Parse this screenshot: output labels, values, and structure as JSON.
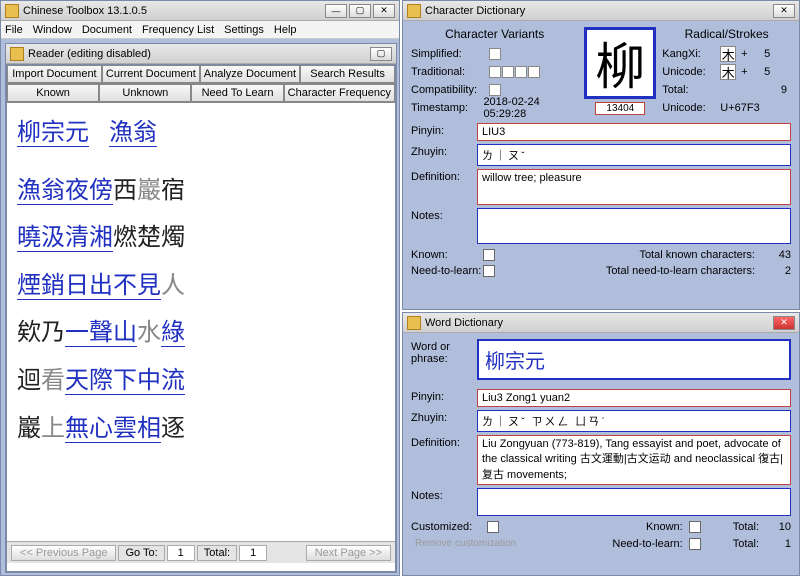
{
  "main": {
    "title": "Chinese Toolbox 13.1.0.5",
    "menu": [
      "File",
      "Window",
      "Document",
      "Frequency List",
      "Settings",
      "Help"
    ]
  },
  "reader": {
    "title": "Reader (editing disabled)",
    "buttons_row1": [
      "Import Document",
      "Current Document",
      "Analyze Document",
      "Search Results"
    ],
    "buttons_row2": [
      "Known",
      "Unknown",
      "Need To Learn",
      "Character Frequency"
    ],
    "poem_title_a": "柳宗元",
    "poem_title_b": "漁翁",
    "lines": [
      [
        [
          "漁翁",
          "kw"
        ],
        [
          "夜傍",
          "kw"
        ],
        [
          "西",
          "p"
        ],
        [
          "巖",
          "lt"
        ],
        [
          "宿",
          "p"
        ]
      ],
      [
        [
          "曉汲",
          "kw"
        ],
        [
          "清湘",
          "kw"
        ],
        [
          "燃",
          "p"
        ],
        [
          "楚",
          "p"
        ],
        [
          "燭",
          "p"
        ]
      ],
      [
        [
          "煙銷",
          "kw"
        ],
        [
          "日出",
          "kw"
        ],
        [
          "不見",
          "kw"
        ],
        [
          "人",
          "lt"
        ]
      ],
      [
        [
          "欸乃",
          "p"
        ],
        [
          "一聲",
          "kw"
        ],
        [
          "山",
          "kw"
        ],
        [
          "水",
          "lt"
        ],
        [
          "綠",
          "kw"
        ]
      ],
      [
        [
          "迴",
          "p"
        ],
        [
          "看",
          "lt"
        ],
        [
          "天際",
          "kw"
        ],
        [
          "下",
          "kw"
        ],
        [
          "中",
          "kw"
        ],
        [
          "流",
          "kw"
        ]
      ],
      [
        [
          "巖",
          "p"
        ],
        [
          "上",
          "lt"
        ],
        [
          "無心",
          "kw"
        ],
        [
          "雲",
          "kw"
        ],
        [
          "相",
          "kw"
        ],
        [
          "逐",
          "p"
        ]
      ]
    ],
    "status": {
      "prev": "<< Previous Page",
      "goto": "Go To:",
      "goto_val": "1",
      "total_lbl": "Total:",
      "total_val": "1",
      "next": "Next Page >>"
    }
  },
  "char_dict": {
    "title": "Character Dictionary",
    "variants_head": "Character Variants",
    "rs_head": "Radical/Strokes",
    "simplified_lbl": "Simplified:",
    "traditional_lbl": "Traditional:",
    "compat_lbl": "Compatibility:",
    "timestamp_lbl": "Timestamp:",
    "timestamp": "2018-02-24 05:29:28",
    "big_char": "柳",
    "char_id": "13404",
    "kangxi_lbl": "KangXi:",
    "unicode_r_lbl": "Unicode:",
    "total_r_lbl": "Total:",
    "unicode_lbl": "Unicode:",
    "radical": "木",
    "kangxi_strokes": "5",
    "unicode_strokes": "5",
    "total_strokes": "9",
    "unicode_val": "U+67F3",
    "pinyin_lbl": "Pinyin:",
    "pinyin": "LIU3",
    "zhuyin_lbl": "Zhuyin:",
    "zhuyin": "ㄌ｜ㄡˇ",
    "def_lbl": "Definition:",
    "definition": "willow tree; pleasure",
    "notes_lbl": "Notes:",
    "notes": "",
    "known_lbl": "Known:",
    "ntl_lbl": "Need-to-learn:",
    "tk_lbl": "Total known characters:",
    "tk_val": "43",
    "tnl_lbl": "Total need-to-learn characters:",
    "tnl_val": "2"
  },
  "word_dict": {
    "title": "Word Dictionary",
    "wp_lbl": "Word or phrase:",
    "word": "柳宗元",
    "pinyin_lbl": "Pinyin:",
    "pinyin": "Liu3 Zong1 yuan2",
    "zhuyin_lbl": "Zhuyin:",
    "zhuyin": "ㄌ｜ㄡˇ ㄗㄨㄥ ㄩㄢˊ",
    "def_lbl": "Definition:",
    "definition": "Liu Zongyuan (773-819), Tang essayist and poet, advocate of the classical writing 古文運動|古文运动 and neoclassical 復古|复古 movements;",
    "notes_lbl": "Notes:",
    "notes": "",
    "custom_lbl": "Customized:",
    "remove_btn": "Remove customization",
    "known_lbl": "Known:",
    "ntl_lbl": "Need-to-learn:",
    "total_lbl": "Total:",
    "total_val": "10",
    "total2_lbl": "Total:",
    "total2_val": "1"
  }
}
